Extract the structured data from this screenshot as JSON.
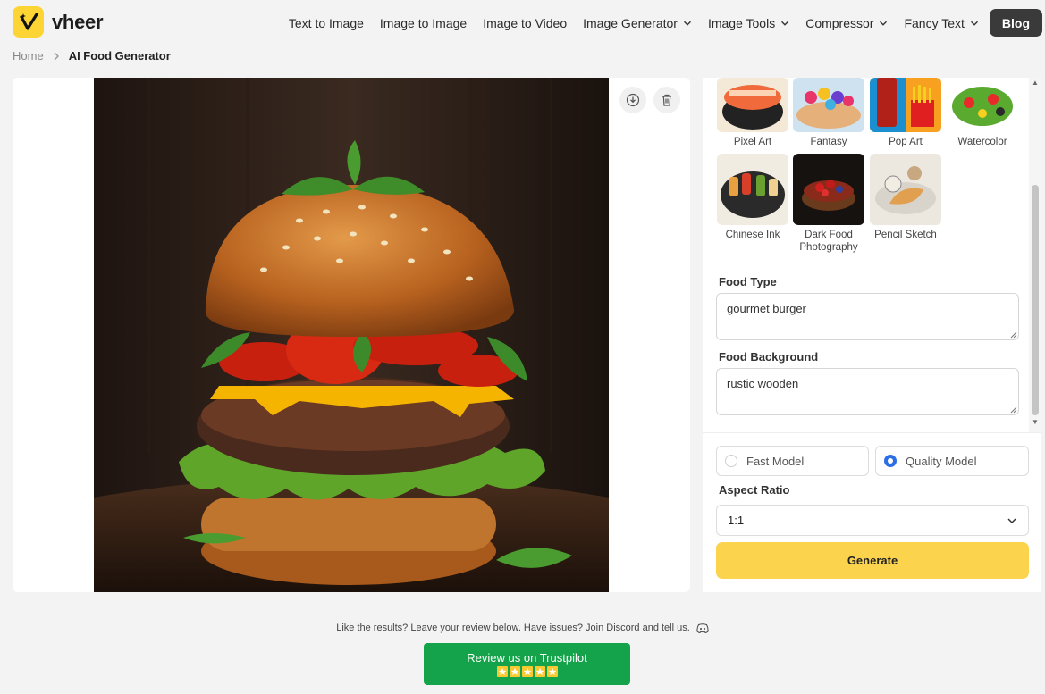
{
  "brand": {
    "name": "vheer"
  },
  "nav": {
    "items": [
      {
        "label": "Text to Image",
        "dropdown": false
      },
      {
        "label": "Image to Image",
        "dropdown": false
      },
      {
        "label": "Image to Video",
        "dropdown": false
      },
      {
        "label": "Image Generator",
        "dropdown": true
      },
      {
        "label": "Image Tools",
        "dropdown": true
      },
      {
        "label": "Compressor",
        "dropdown": true
      },
      {
        "label": "Fancy Text",
        "dropdown": true
      }
    ],
    "blog_label": "Blog"
  },
  "breadcrumb": {
    "home": "Home",
    "current": "AI Food Generator"
  },
  "styles": [
    {
      "label": "Pixel Art"
    },
    {
      "label": "Fantasy"
    },
    {
      "label": "Pop Art"
    },
    {
      "label": "Watercolor"
    },
    {
      "label": "Chinese Ink"
    },
    {
      "label": "Dark Food Photography"
    },
    {
      "label": "Pencil Sketch"
    }
  ],
  "form": {
    "food_type_label": "Food Type",
    "food_type_value": "gourmet burger",
    "food_background_label": "Food Background",
    "food_background_value": "rustic wooden",
    "models": [
      {
        "label": "Fast Model",
        "selected": false
      },
      {
        "label": "Quality Model",
        "selected": true
      }
    ],
    "aspect_ratio_label": "Aspect Ratio",
    "aspect_ratio_value": "1:1",
    "generate_label": "Generate"
  },
  "footer": {
    "review_text": "Like the results? Leave your review below. Have issues? Join Discord and tell us.",
    "trustpilot_label": "Review us on Trustpilot",
    "stars": 5
  },
  "colors": {
    "brand_yellow": "#fcd535",
    "generate_yellow": "#fcd34d",
    "radio_blue": "#2d6ee6",
    "trustpilot_green": "#14a34a",
    "blog_dark": "#3a3a3a"
  }
}
